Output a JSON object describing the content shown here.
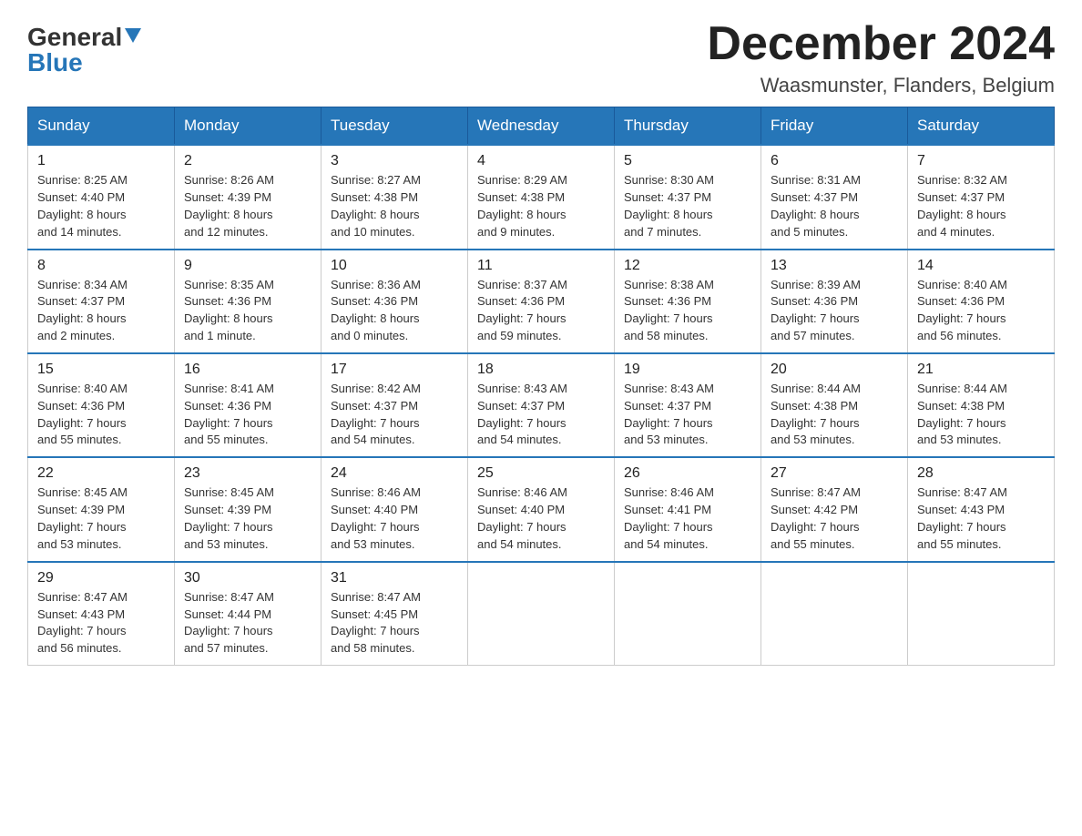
{
  "header": {
    "logo_line1": "General",
    "logo_line2": "Blue",
    "title": "December 2024",
    "subtitle": "Waasmunster, Flanders, Belgium"
  },
  "days_of_week": [
    "Sunday",
    "Monday",
    "Tuesday",
    "Wednesday",
    "Thursday",
    "Friday",
    "Saturday"
  ],
  "weeks": [
    [
      {
        "num": "1",
        "info": "Sunrise: 8:25 AM\nSunset: 4:40 PM\nDaylight: 8 hours\nand 14 minutes."
      },
      {
        "num": "2",
        "info": "Sunrise: 8:26 AM\nSunset: 4:39 PM\nDaylight: 8 hours\nand 12 minutes."
      },
      {
        "num": "3",
        "info": "Sunrise: 8:27 AM\nSunset: 4:38 PM\nDaylight: 8 hours\nand 10 minutes."
      },
      {
        "num": "4",
        "info": "Sunrise: 8:29 AM\nSunset: 4:38 PM\nDaylight: 8 hours\nand 9 minutes."
      },
      {
        "num": "5",
        "info": "Sunrise: 8:30 AM\nSunset: 4:37 PM\nDaylight: 8 hours\nand 7 minutes."
      },
      {
        "num": "6",
        "info": "Sunrise: 8:31 AM\nSunset: 4:37 PM\nDaylight: 8 hours\nand 5 minutes."
      },
      {
        "num": "7",
        "info": "Sunrise: 8:32 AM\nSunset: 4:37 PM\nDaylight: 8 hours\nand 4 minutes."
      }
    ],
    [
      {
        "num": "8",
        "info": "Sunrise: 8:34 AM\nSunset: 4:37 PM\nDaylight: 8 hours\nand 2 minutes."
      },
      {
        "num": "9",
        "info": "Sunrise: 8:35 AM\nSunset: 4:36 PM\nDaylight: 8 hours\nand 1 minute."
      },
      {
        "num": "10",
        "info": "Sunrise: 8:36 AM\nSunset: 4:36 PM\nDaylight: 8 hours\nand 0 minutes."
      },
      {
        "num": "11",
        "info": "Sunrise: 8:37 AM\nSunset: 4:36 PM\nDaylight: 7 hours\nand 59 minutes."
      },
      {
        "num": "12",
        "info": "Sunrise: 8:38 AM\nSunset: 4:36 PM\nDaylight: 7 hours\nand 58 minutes."
      },
      {
        "num": "13",
        "info": "Sunrise: 8:39 AM\nSunset: 4:36 PM\nDaylight: 7 hours\nand 57 minutes."
      },
      {
        "num": "14",
        "info": "Sunrise: 8:40 AM\nSunset: 4:36 PM\nDaylight: 7 hours\nand 56 minutes."
      }
    ],
    [
      {
        "num": "15",
        "info": "Sunrise: 8:40 AM\nSunset: 4:36 PM\nDaylight: 7 hours\nand 55 minutes."
      },
      {
        "num": "16",
        "info": "Sunrise: 8:41 AM\nSunset: 4:36 PM\nDaylight: 7 hours\nand 55 minutes."
      },
      {
        "num": "17",
        "info": "Sunrise: 8:42 AM\nSunset: 4:37 PM\nDaylight: 7 hours\nand 54 minutes."
      },
      {
        "num": "18",
        "info": "Sunrise: 8:43 AM\nSunset: 4:37 PM\nDaylight: 7 hours\nand 54 minutes."
      },
      {
        "num": "19",
        "info": "Sunrise: 8:43 AM\nSunset: 4:37 PM\nDaylight: 7 hours\nand 53 minutes."
      },
      {
        "num": "20",
        "info": "Sunrise: 8:44 AM\nSunset: 4:38 PM\nDaylight: 7 hours\nand 53 minutes."
      },
      {
        "num": "21",
        "info": "Sunrise: 8:44 AM\nSunset: 4:38 PM\nDaylight: 7 hours\nand 53 minutes."
      }
    ],
    [
      {
        "num": "22",
        "info": "Sunrise: 8:45 AM\nSunset: 4:39 PM\nDaylight: 7 hours\nand 53 minutes."
      },
      {
        "num": "23",
        "info": "Sunrise: 8:45 AM\nSunset: 4:39 PM\nDaylight: 7 hours\nand 53 minutes."
      },
      {
        "num": "24",
        "info": "Sunrise: 8:46 AM\nSunset: 4:40 PM\nDaylight: 7 hours\nand 53 minutes."
      },
      {
        "num": "25",
        "info": "Sunrise: 8:46 AM\nSunset: 4:40 PM\nDaylight: 7 hours\nand 54 minutes."
      },
      {
        "num": "26",
        "info": "Sunrise: 8:46 AM\nSunset: 4:41 PM\nDaylight: 7 hours\nand 54 minutes."
      },
      {
        "num": "27",
        "info": "Sunrise: 8:47 AM\nSunset: 4:42 PM\nDaylight: 7 hours\nand 55 minutes."
      },
      {
        "num": "28",
        "info": "Sunrise: 8:47 AM\nSunset: 4:43 PM\nDaylight: 7 hours\nand 55 minutes."
      }
    ],
    [
      {
        "num": "29",
        "info": "Sunrise: 8:47 AM\nSunset: 4:43 PM\nDaylight: 7 hours\nand 56 minutes."
      },
      {
        "num": "30",
        "info": "Sunrise: 8:47 AM\nSunset: 4:44 PM\nDaylight: 7 hours\nand 57 minutes."
      },
      {
        "num": "31",
        "info": "Sunrise: 8:47 AM\nSunset: 4:45 PM\nDaylight: 7 hours\nand 58 minutes."
      },
      null,
      null,
      null,
      null
    ]
  ]
}
